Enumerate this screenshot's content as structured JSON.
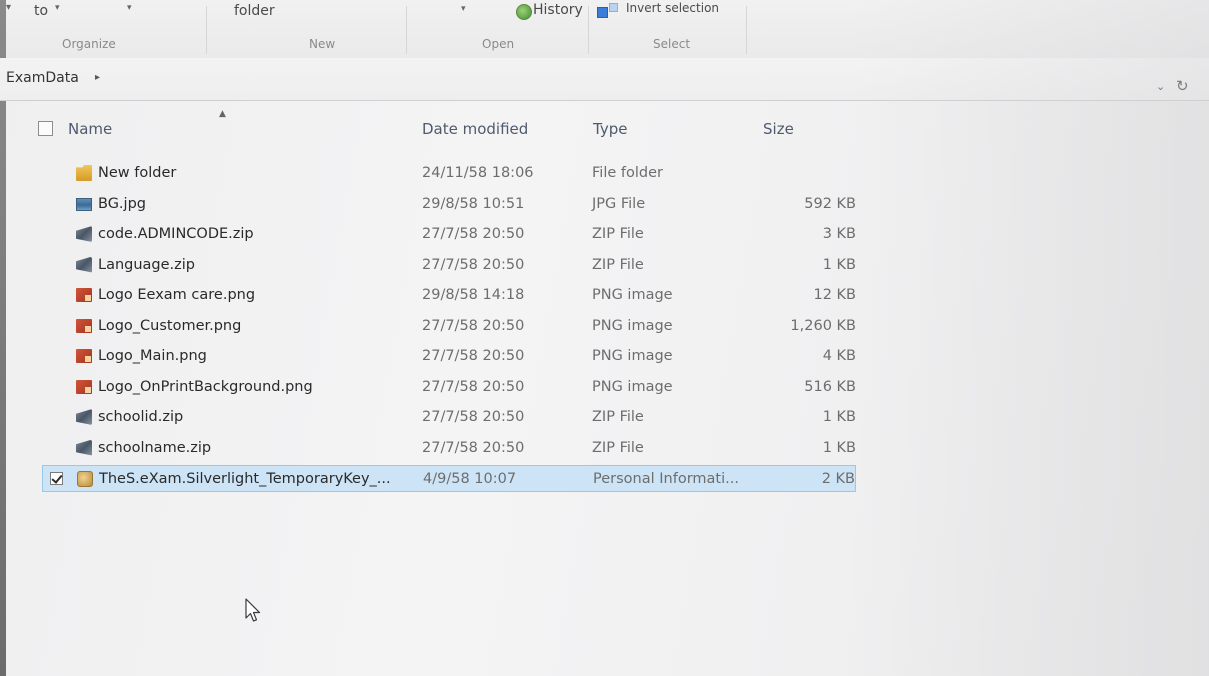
{
  "ribbon": {
    "fragments": {
      "to": "to",
      "folder": "folder",
      "history": "History",
      "invert_selection": "Invert selection"
    },
    "groups": {
      "organize": "Organize",
      "new": "New",
      "open": "Open",
      "select": "Select"
    }
  },
  "address": {
    "breadcrumb": "ExamData",
    "refresh_icon": "refresh-icon",
    "dropdown_icon": "chevron-down-icon"
  },
  "columns": {
    "name": "Name",
    "date": "Date modified",
    "type": "Type",
    "size": "Size"
  },
  "files": [
    {
      "name": "New folder",
      "date": "24/11/58 18:06",
      "type": "File folder",
      "size": "",
      "icon": "folder-icon"
    },
    {
      "name": "BG.jpg",
      "date": "29/8/58 10:51",
      "type": "JPG File",
      "size": "592 KB",
      "icon": "image-file-icon"
    },
    {
      "name": "code.ADMINCODE.zip",
      "date": "27/7/58 20:50",
      "type": "ZIP File",
      "size": "3 KB",
      "icon": "zip-file-icon"
    },
    {
      "name": "Language.zip",
      "date": "27/7/58 20:50",
      "type": "ZIP File",
      "size": "1 KB",
      "icon": "zip-file-icon"
    },
    {
      "name": "Logo Eexam care.png",
      "date": "29/8/58 14:18",
      "type": "PNG image",
      "size": "12 KB",
      "icon": "png-file-icon"
    },
    {
      "name": "Logo_Customer.png",
      "date": "27/7/58 20:50",
      "type": "PNG image",
      "size": "1,260 KB",
      "icon": "png-file-icon"
    },
    {
      "name": "Logo_Main.png",
      "date": "27/7/58 20:50",
      "type": "PNG image",
      "size": "4 KB",
      "icon": "png-file-icon"
    },
    {
      "name": "Logo_OnPrintBackground.png",
      "date": "27/7/58 20:50",
      "type": "PNG image",
      "size": "516 KB",
      "icon": "png-file-icon"
    },
    {
      "name": "schoolid.zip",
      "date": "27/7/58 20:50",
      "type": "ZIP File",
      "size": "1 KB",
      "icon": "zip-file-icon"
    },
    {
      "name": "schoolname.zip",
      "date": "27/7/58 20:50",
      "type": "ZIP File",
      "size": "1 KB",
      "icon": "zip-file-icon"
    },
    {
      "name": "TheS.eXam.Silverlight_TemporaryKey_...",
      "date": "4/9/58 10:07",
      "type": "Personal Informati...",
      "size": "2 KB",
      "icon": "certificate-file-icon",
      "selected": true
    }
  ],
  "colors": {
    "selection_bg": "#cde4f7",
    "selection_border": "#99c8ea",
    "header_text": "#4e5a6e"
  }
}
